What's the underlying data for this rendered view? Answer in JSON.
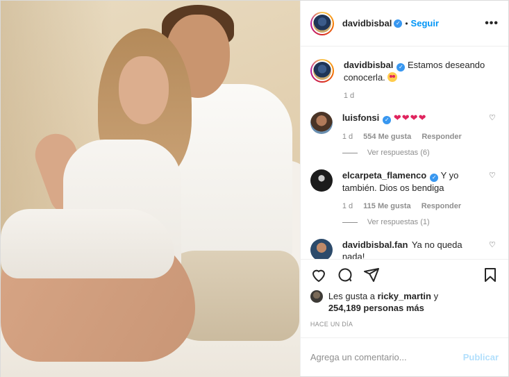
{
  "post": {
    "author": "davidbisbal",
    "follow_label": "Seguir",
    "separator": "•",
    "more_icon": "more-horizontal-icon",
    "verified_icon": "verified-badge-icon"
  },
  "caption": {
    "username": "davidbisbal",
    "text": "Estamos deseando conocerla.",
    "emoji": "heart-eyes-emoji",
    "age": "1 d"
  },
  "comments": [
    {
      "username": "luisfonsi",
      "verified": true,
      "text": "❤❤❤❤",
      "age": "1 d",
      "likes": "554 Me gusta",
      "reply_label": "Responder",
      "view_replies": "Ver respuestas (6)"
    },
    {
      "username": "elcarpeta_flamenco",
      "verified": true,
      "text": "Y yo también. Dios os bendiga",
      "age": "1 d",
      "likes": "115 Me gusta",
      "reply_label": "Responder",
      "view_replies": "Ver respuestas (1)"
    },
    {
      "username": "davidbisbal.fan",
      "verified": false,
      "text": "Ya no queda nada!"
    }
  ],
  "actions": {
    "like_icon": "heart-outline-icon",
    "comment_icon": "comment-bubble-icon",
    "share_icon": "paper-plane-icon",
    "save_icon": "bookmark-icon"
  },
  "likes": {
    "prefix": "Les gusta a",
    "user": "ricky_martin",
    "connector": "y",
    "count": "254,189 personas más"
  },
  "timestamp": "HACE UN DÍA",
  "add_comment": {
    "placeholder": "Agrega un comentario...",
    "publish_label": "Publicar"
  },
  "colors": {
    "accent": "#0095f6",
    "publish_disabled": "#b2dffc",
    "heart_red": "#e0245e",
    "muted": "#8e8e8e"
  }
}
